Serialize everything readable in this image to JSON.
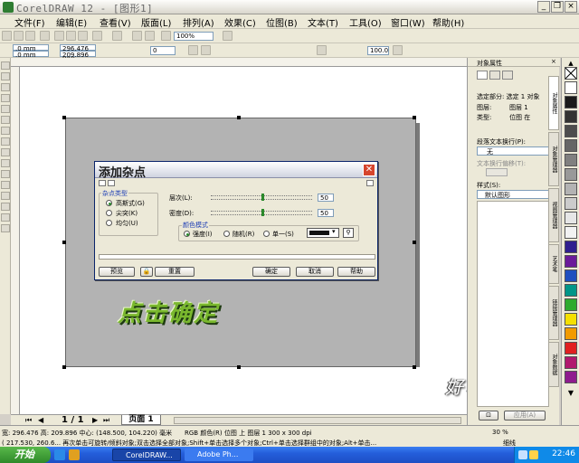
{
  "window": {
    "title": "CorelDRAW 12 - [图形1]"
  },
  "menu": [
    {
      "label": "文件(F)"
    },
    {
      "label": "编辑(E)"
    },
    {
      "label": "查看(V)"
    },
    {
      "label": "版面(L)"
    },
    {
      "label": "排列(A)"
    },
    {
      "label": "效果(C)"
    },
    {
      "label": "位图(B)"
    },
    {
      "label": "文本(T)"
    },
    {
      "label": "工具(O)"
    },
    {
      "label": "窗口(W)"
    },
    {
      "label": "帮助(H)"
    }
  ],
  "toolbar": {
    "zoom": "100%",
    "zoom2": "100.0",
    "x": ".0 mm",
    "y": ".0 mm",
    "w": "296.476 mm",
    "h": "209.896 mm",
    "rot": "0"
  },
  "dialog": {
    "title": "添加杂点",
    "noise_type_label": "杂点类型",
    "noise_types": [
      {
        "label": "高斯式(G)",
        "selected": true
      },
      {
        "label": "尖突(K)",
        "selected": false
      },
      {
        "label": "均匀(U)",
        "selected": false
      }
    ],
    "level_label": "层次(L):",
    "level_value": "50",
    "level_fraction": 0.5,
    "density_label": "密度(D):",
    "density_value": "50",
    "density_fraction": 0.5,
    "color_mode_label": "颜色模式",
    "color_modes": [
      {
        "label": "强度(I)",
        "selected": true
      },
      {
        "label": "随机(R)",
        "selected": false
      },
      {
        "label": "单一(S)",
        "selected": false
      }
    ],
    "buttons": {
      "preview": "预览",
      "reset": "重置",
      "ok": "确定",
      "cancel": "取消",
      "help": "帮助"
    }
  },
  "caption": "点击确定",
  "signature": "好心情",
  "pagebar": {
    "counter": "1 / 1",
    "page_tab": "页面 1"
  },
  "status": {
    "line1": "宽: 296.476  高: 209.896  中心: (148.500, 104.220)  毫米",
    "line1b": "RGB 颜色(R) 位图 上 图层 1 300 x 300 dpi",
    "line2": "( 217.530, 260.6...   再次单击可旋转/倾斜对象;双击选择全部对象;Shift+单击选择多个对象;Ctrl+单击选择群组中的对象;Alt+单击...",
    "zoom_pct": "30 %",
    "outline_label": "细线"
  },
  "docker": {
    "title": "对象属性",
    "tabs": [
      "对象属性",
      "对象管理器",
      "视图管理器",
      "艺术笔",
      "链接管理器",
      "对象数据"
    ],
    "selected_label": "选定部分: 选定 1 对象",
    "layer_label": "图层:",
    "layer_value": "图层 1",
    "type_label": "类型:",
    "type_value": "位图 在",
    "wrap_label": "段落文本换行(P):",
    "wrap_value": "无",
    "offset_label": "文本换行偏移(T):",
    "style_label": "样式(S):",
    "style_value": "默认图形",
    "apply_label": "应用(A)"
  },
  "palette": {
    "colors": [
      "#ffffff",
      "#1a1a1a",
      "#333333",
      "#4d4d4d",
      "#666666",
      "#808080",
      "#999999",
      "#b3b3b3",
      "#cccccc",
      "#e6e6e6",
      "#f2f2f2",
      "#2f1f8f",
      "#6a1b9a",
      "#1f4fbf",
      "#009688",
      "#2eaa2e",
      "#f5e000",
      "#f29b00",
      "#e02020",
      "#b0186e",
      "#8e1b8e"
    ]
  },
  "taskbar": {
    "start": "开始",
    "tasks": [
      "CorelDRAW...",
      "Adobe Ph..."
    ],
    "clock": "22:46"
  },
  "colors": {
    "dialog_accent": "#1f3fb5",
    "radio_dot": "#2b8a2b",
    "caption_green": "#7ab82e"
  }
}
